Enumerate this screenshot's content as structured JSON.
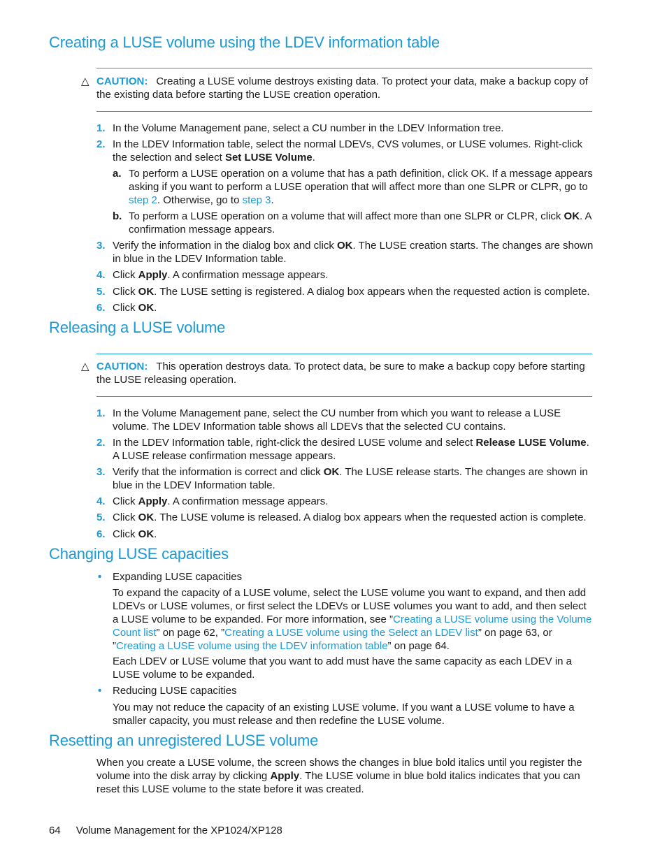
{
  "sections": [
    {
      "title": "Creating a LUSE volume using the LDEV information table",
      "caution": {
        "label": "CAUTION:",
        "text": "Creating a LUSE volume destroys existing data. To protect your data, make a backup copy of the existing data before starting the LUSE creation operation."
      },
      "steps": [
        {
          "num": "1.",
          "parts": [
            "In the Volume Management pane, select a CU number in the LDEV Information tree."
          ]
        },
        {
          "num": "2.",
          "pre": "In the LDEV Information table, select the normal LDEVs, CVS volumes, or LUSE volumes. Right-click the selection and select ",
          "bold": "Set LUSE Volume",
          "post": "."
        },
        {
          "num": "3.",
          "pre": "Verify the information in the dialog box and click ",
          "bold": "OK",
          "post": ". The LUSE creation starts. The changes are shown in blue in the LDEV Information table."
        },
        {
          "num": "4.",
          "pre": "Click ",
          "bold": "Apply",
          "post": ". A confirmation message appears."
        },
        {
          "num": "5.",
          "pre": "Click ",
          "bold": "OK",
          "post": ". The LUSE setting is registered. A dialog box appears when the requested action is complete."
        },
        {
          "num": "6.",
          "pre": "Click ",
          "bold": "OK",
          "post": "."
        }
      ],
      "substeps": [
        {
          "num": "a.",
          "pre": "To perform a LUSE operation on a volume that has a path definition, click OK. If a message appears asking if you want to perform a LUSE operation that will affect more than one SLPR or CLPR, go to ",
          "link1": "step 2",
          "mid": ". Otherwise, go to ",
          "link2": "step 3",
          "post": "."
        },
        {
          "num": "b.",
          "pre": "To perform a LUSE operation on a volume that will affect more than one SLPR or CLPR, click ",
          "bold": "OK",
          "post": ". A confirmation message appears."
        }
      ]
    },
    {
      "title": "Releasing a LUSE volume",
      "caution": {
        "label": "CAUTION:",
        "text": "This operation destroys data. To protect data, be sure to make a backup copy before starting the LUSE releasing operation."
      },
      "steps": [
        {
          "num": "1.",
          "pre": "In the Volume Management pane, select the CU number from which you want to release a LUSE volume. The LDEV Information table shows all LDEVs that the selected CU contains."
        },
        {
          "num": "2.",
          "pre": "In the LDEV Information table, right-click the desired LUSE volume and select ",
          "bold": "Release LUSE Volume",
          "post": ". A LUSE release confirmation message appears."
        },
        {
          "num": "3.",
          "pre": "Verify that the information is correct and click ",
          "bold": "OK",
          "post": ". The LUSE release starts. The changes are shown in blue in the LDEV Information table."
        },
        {
          "num": "4.",
          "pre": "Click ",
          "bold": "Apply",
          "post": ". A confirmation message appears."
        },
        {
          "num": "5.",
          "pre": "Click ",
          "bold": "OK",
          "post": ". The LUSE volume is released. A dialog box appears when the requested action is complete."
        },
        {
          "num": "6.",
          "pre": "Click ",
          "bold": "OK",
          "post": "."
        }
      ]
    },
    {
      "title": "Changing LUSE capacities",
      "bullets": [
        {
          "label": "Expanding LUSE capacities",
          "para1_pre": "To expand the capacity of a LUSE volume, select the LUSE volume you want to expand, and then add LDEVs or LUSE volumes, or first select the LDEVs or LUSE volumes you want to add, and then select a LUSE volume to be expanded. For more information, see ”",
          "link1": "Creating a LUSE volume using the Volume Count list",
          "mid1": "” on page 62, ”",
          "link2": "Creating a LUSE volume using the Select an LDEV list",
          "mid2": "” on page 63, or ”",
          "link3": "Creating a LUSE volume using the LDEV information table",
          "post": "” on page 64.",
          "para2": "Each LDEV or LUSE volume that you want to add must have the same capacity as each LDEV in a LUSE volume to be expanded."
        },
        {
          "label": "Reducing LUSE capacities",
          "para1": "You may not reduce the capacity of an existing LUSE volume. If you want a LUSE volume to have a smaller capacity, you must release and then redefine the LUSE volume."
        }
      ]
    },
    {
      "title": "Resetting an unregistered LUSE volume",
      "pre": "When you create a LUSE volume, the screen shows the changes in blue bold italics until you register the volume into the disk array by clicking ",
      "bold": "Apply",
      "post": ". The LUSE volume in blue bold italics indicates that you can reset this LUSE volume to the state before it was created."
    }
  ],
  "footer": {
    "page_number": "64",
    "title": "Volume Management for the XP1024/XP128"
  },
  "icons": {
    "caution": "△",
    "bullet": "•"
  },
  "colors": {
    "accent": "#1a9ad6",
    "text": "#1a1a1a"
  }
}
